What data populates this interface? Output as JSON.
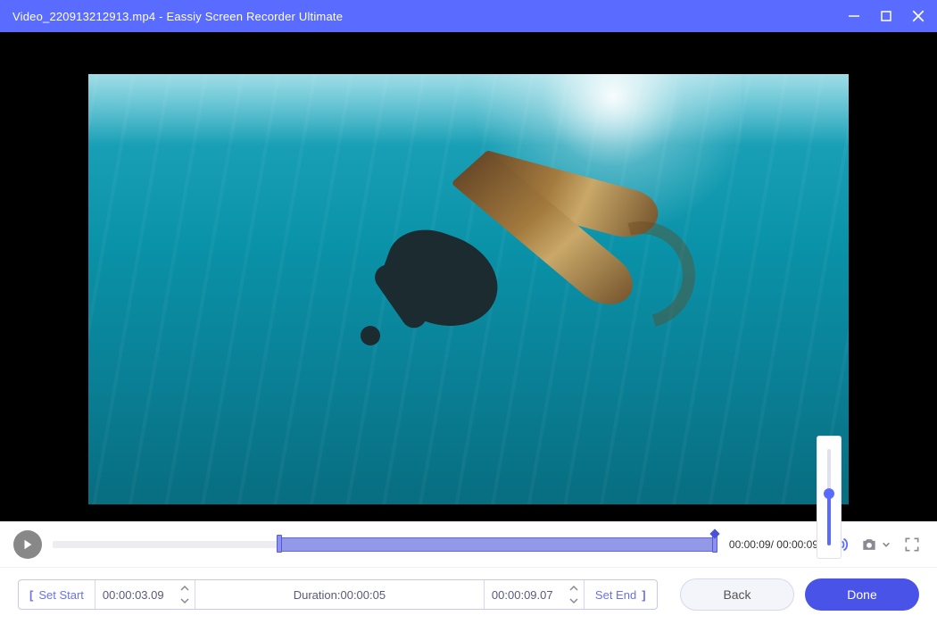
{
  "titlebar": {
    "filename": "Video_220913212913.mp4",
    "separator": "  -  ",
    "appname": "Eassiy Screen Recorder Ultimate"
  },
  "playback": {
    "current_time": "00:00:09",
    "total_time": "00:00:09"
  },
  "trim": {
    "set_start_label": "Set Start",
    "start_time": "00:00:03.09",
    "duration_label": "Duration:",
    "duration_value": "00:00:05",
    "end_time": "00:00:09.07",
    "set_end_label": "Set End"
  },
  "buttons": {
    "back": "Back",
    "done": "Done"
  },
  "volume": {
    "percent": 52
  }
}
